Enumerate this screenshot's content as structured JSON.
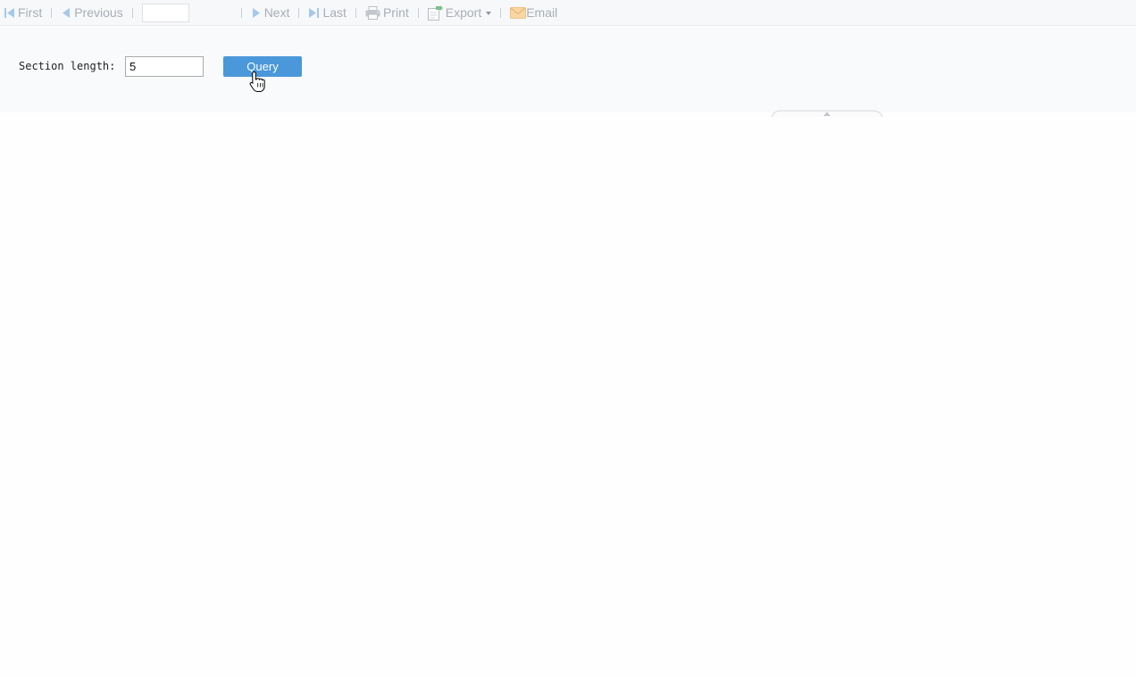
{
  "toolbar": {
    "first": {
      "label": "First",
      "icon": "first-page-icon"
    },
    "previous": {
      "label": "Previous",
      "icon": "previous-page-icon"
    },
    "page_input": {
      "value": ""
    },
    "next": {
      "label": "Next",
      "icon": "next-page-icon"
    },
    "last": {
      "label": "Last",
      "icon": "last-page-icon"
    },
    "print": {
      "label": "Print",
      "icon": "printer-icon"
    },
    "export": {
      "label": "Export",
      "icon": "export-icon"
    },
    "email": {
      "label": "Email",
      "icon": "envelope-icon"
    }
  },
  "params": {
    "section_length_label": "Section length:",
    "section_length_value": "5",
    "query_label": "Query"
  },
  "colors": {
    "accent": "#4a98da",
    "nav_icon": "#a6c8ea",
    "toolbar_text": "#a8aeb5",
    "email_icon": "#f5c98a",
    "export_icon": "#7cc08a"
  }
}
